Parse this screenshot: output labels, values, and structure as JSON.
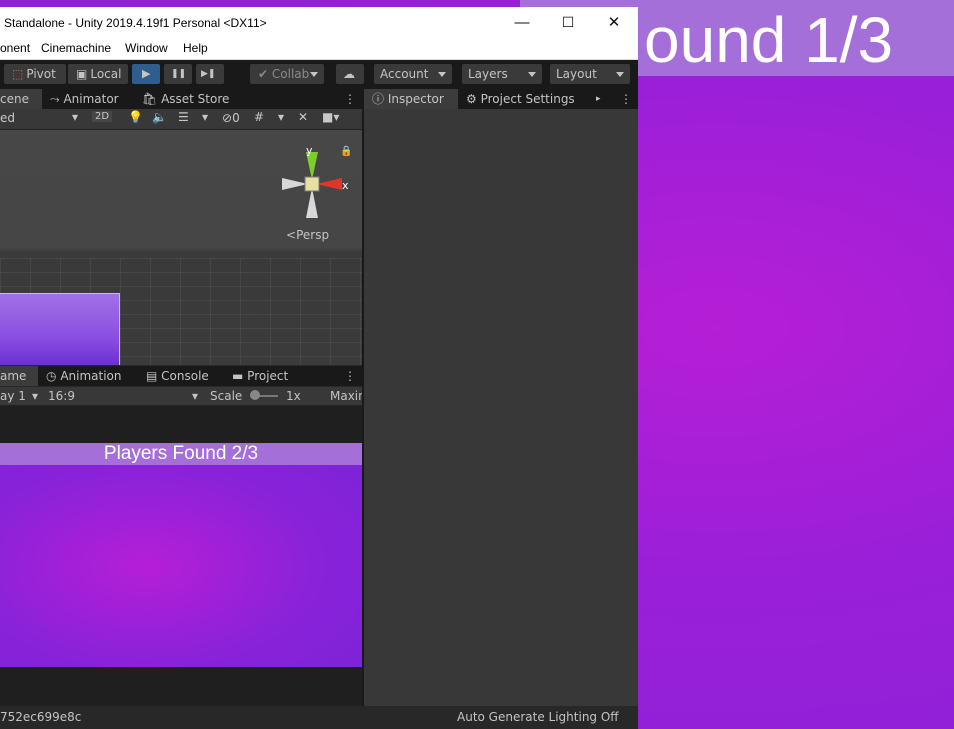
{
  "background_game": {
    "banner_text": "ound 1/3",
    "accent": "#a56fd9",
    "background": "#8a22d9"
  },
  "window": {
    "title": "Standalone - Unity 2019.4.19f1 Personal <DX11>",
    "minimize": "—",
    "maximize": "☐",
    "close": "✕"
  },
  "menu": {
    "items": [
      "onent",
      "Cinemachine",
      "Window",
      "Help"
    ]
  },
  "toolbar": {
    "pivot": "Pivot",
    "local": "Local",
    "play": "▶",
    "pause": "❚❚",
    "step": "▶❚",
    "collab": "Collab",
    "account": "Account",
    "layers": "Layers",
    "layout": "Layout"
  },
  "scene_tabs": {
    "scene": "cene",
    "animator": "Animator",
    "asset_store": "Asset Store"
  },
  "scene_toolbar": {
    "shading": "ed",
    "mode_2d": "2D",
    "hidden_count": "0"
  },
  "gizmo": {
    "y": "y",
    "x": "x",
    "persp": "Persp"
  },
  "game_tabs": {
    "game": "ame",
    "animation": "Animation",
    "console": "Console",
    "project": "Project"
  },
  "game_toolbar": {
    "display": "ay 1",
    "aspect": "16:9",
    "scale_label": "Scale",
    "scale_value": "1x",
    "maximize": "Maxin"
  },
  "game_view": {
    "banner_text": "Players Found 2/3"
  },
  "inspector_tabs": {
    "inspector": "Inspector",
    "project_settings": "Project Settings"
  },
  "status": {
    "left": "752ec699e8c",
    "right": "Auto Generate Lighting Off"
  }
}
